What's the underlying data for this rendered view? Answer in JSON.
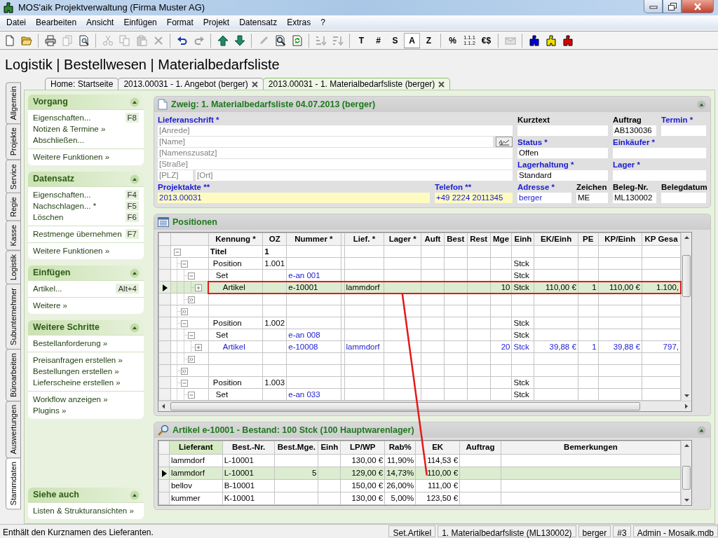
{
  "window": {
    "title": "MOS'aik Projektverwaltung (Firma Muster AG)"
  },
  "menu": [
    "Datei",
    "Bearbeiten",
    "Ansicht",
    "Einfügen",
    "Format",
    "Projekt",
    "Datensatz",
    "Extras",
    "?"
  ],
  "toolbar": [
    {
      "kind": "icon",
      "disabled": false
    },
    {
      "kind": "icon",
      "disabled": false
    },
    {
      "kind": "separator"
    },
    {
      "kind": "icon",
      "disabled": false
    },
    {
      "kind": "icon",
      "disabled": true
    },
    {
      "kind": "icon",
      "disabled": false
    },
    {
      "kind": "separator"
    },
    {
      "kind": "icon",
      "disabled": true
    },
    {
      "kind": "icon",
      "disabled": true
    },
    {
      "kind": "icon",
      "disabled": true
    },
    {
      "kind": "icon",
      "disabled": true
    },
    {
      "kind": "separator"
    },
    {
      "kind": "icon",
      "disabled": false
    },
    {
      "kind": "icon",
      "disabled": true
    },
    {
      "kind": "separator"
    },
    {
      "kind": "icon",
      "disabled": false
    },
    {
      "kind": "icon",
      "disabled": false
    },
    {
      "kind": "separator"
    },
    {
      "kind": "icon",
      "disabled": true
    },
    {
      "kind": "icon",
      "disabled": false
    },
    {
      "kind": "icon",
      "disabled": false
    },
    {
      "kind": "separator"
    },
    {
      "kind": "icon",
      "disabled": true
    },
    {
      "kind": "icon",
      "disabled": true
    },
    {
      "kind": "separator"
    },
    {
      "kind": "text",
      "label": "T",
      "selected": false
    },
    {
      "kind": "text",
      "label": "#",
      "selected": false
    },
    {
      "kind": "text",
      "label": "S",
      "selected": false
    },
    {
      "kind": "text",
      "label": "A",
      "selected": true
    },
    {
      "kind": "text",
      "label": "Z",
      "selected": false
    },
    {
      "kind": "separator"
    },
    {
      "kind": "text",
      "label": "%",
      "selected": false
    },
    {
      "kind": "text",
      "label": "1.1.1 1.1.2",
      "selected": false
    },
    {
      "kind": "text",
      "label": "€$",
      "selected": false
    },
    {
      "kind": "separator"
    },
    {
      "kind": "icon",
      "disabled": true
    },
    {
      "kind": "separator"
    },
    {
      "kind": "icon",
      "disabled": false,
      "color": "#0000e0"
    },
    {
      "kind": "icon",
      "disabled": false,
      "color": "#f0e000"
    },
    {
      "kind": "icon",
      "disabled": false,
      "color": "#e00000"
    }
  ],
  "page_title": "Logistik | Bestellwesen | Materialbedarfsliste",
  "side_tabs": [
    {
      "label": "Allgemein",
      "selected": false
    },
    {
      "label": "Projekte",
      "selected": false
    },
    {
      "label": "Service",
      "selected": false
    },
    {
      "label": "Regie",
      "selected": false
    },
    {
      "label": "Kasse",
      "selected": false
    },
    {
      "label": "Logistik",
      "selected": false
    },
    {
      "label": "Subunternehmer",
      "selected": false
    },
    {
      "label": "Büroarbeiten",
      "selected": false
    },
    {
      "label": "Auswertungen",
      "selected": false
    },
    {
      "label": "Stammdaten",
      "selected": true
    }
  ],
  "doc_tabs": [
    {
      "label": "Home: Startseite",
      "selected": false,
      "closable": false
    },
    {
      "label": "2013.00031 - 1. Angebot (berger)",
      "selected": false,
      "closable": true
    },
    {
      "label": "2013.00031 - 1. Materialbedarfsliste (berger)",
      "selected": true,
      "closable": true
    }
  ],
  "task_sections": [
    {
      "title": "Vorgang",
      "expanded": true,
      "groups": [
        [
          {
            "label": "Eigenschaften...",
            "shortcut": "F8"
          },
          {
            "label": "Notizen & Termine »"
          },
          {
            "label": "Abschließen..."
          }
        ],
        [
          {
            "label": "Weitere Funktionen »"
          }
        ]
      ]
    },
    {
      "title": "Datensatz",
      "expanded": true,
      "groups": [
        [
          {
            "label": "Eigenschaften...",
            "shortcut": "F4"
          },
          {
            "label": "Nachschlagen... *",
            "shortcut": "F5"
          },
          {
            "label": "Löschen",
            "shortcut": "F6"
          }
        ],
        [
          {
            "label": "Restmenge übernehmen",
            "shortcut": "F7"
          }
        ],
        [
          {
            "label": "Weitere Funktionen »"
          }
        ]
      ]
    },
    {
      "title": "Einfügen",
      "expanded": true,
      "groups": [
        [
          {
            "label": "Artikel...",
            "shortcut": "Alt+4"
          }
        ],
        [
          {
            "label": "Weitere »"
          }
        ]
      ]
    },
    {
      "title": "Weitere Schritte",
      "expanded": true,
      "groups": [
        [
          {
            "label": "Bestellanforderung »"
          }
        ],
        [
          {
            "label": "Preisanfragen erstellen »"
          },
          {
            "label": "Bestellungen erstellen »"
          },
          {
            "label": "Lieferscheine erstellen »"
          }
        ],
        [
          {
            "label": "Workflow anzeigen »"
          },
          {
            "label": "Plugins »"
          }
        ]
      ]
    },
    {
      "title": "Siehe auch",
      "expanded": true,
      "groups": [
        [
          {
            "label": "Listen & Strukturansichten »"
          }
        ]
      ]
    }
  ],
  "branch_panel": {
    "title": "Zweig: 1. Materialbedarfsliste 04.07.2013 (berger)",
    "expanded": true,
    "address_label": {
      "text": "Lieferanschrift *",
      "required": true
    },
    "address_fields": [
      {
        "placeholder": "[Anrede]",
        "lookup": false
      },
      {
        "placeholder": "[Name]",
        "lookup": true
      },
      {
        "placeholder": "[Namenszusatz]",
        "lookup": false
      },
      {
        "placeholder": "[Straße]",
        "lookup": false
      },
      {
        "placeholder": "[PLZ]",
        "lookup": false
      },
      {
        "placeholder": "[Ort]",
        "lookup": false
      }
    ],
    "fields": [
      {
        "label": "Kurztext",
        "required": false,
        "linked": false,
        "highlighted": false
      },
      {
        "label": "Auftrag",
        "required": false,
        "value": "AB130036",
        "linked": false,
        "highlighted": false
      },
      {
        "label": "Termin *",
        "required": true,
        "linked": false,
        "highlighted": false
      },
      {
        "label": "Status *",
        "required": true,
        "value": "Offen",
        "linked": false,
        "highlighted": false
      },
      {
        "label": "Einkäufer *",
        "required": true,
        "linked": false,
        "highlighted": false
      },
      {
        "label": "Lagerhaltung *",
        "required": true,
        "value": "Standard",
        "linked": false,
        "highlighted": false
      },
      {
        "label": "Lager *",
        "required": true,
        "linked": false,
        "highlighted": false
      },
      {
        "label": "Projektakte **",
        "required": true,
        "value": "2013.00031",
        "linked": true,
        "highlighted": true
      },
      {
        "label": "Telefon **",
        "required": true,
        "value": "+49 2224 2011345",
        "linked": true,
        "highlighted": true
      },
      {
        "label": "Adresse *",
        "required": true,
        "value": "berger",
        "linked": true,
        "highlighted": false
      },
      {
        "label": "Zeichen",
        "required": false,
        "value": "ME",
        "linked": false,
        "highlighted": false
      },
      {
        "label": "Beleg-Nr.",
        "required": false,
        "value": "ML130002",
        "linked": false,
        "highlighted": false
      },
      {
        "label": "Belegdatum",
        "required": false,
        "linked": false,
        "highlighted": false
      }
    ]
  },
  "positions_panel": {
    "title": "Positionen",
    "columns": [
      "Kennung *",
      "OZ",
      "Nummer *",
      "Lief. *",
      "Lager *",
      "Auft",
      "Best",
      "Rest",
      "Mge",
      "Einh",
      "EK/Einh",
      "PE",
      "KP/Einh",
      "KP Gesa"
    ],
    "tree": [
      {
        "kind": "title",
        "expanded": true,
        "selected": false,
        "linked": false,
        "cells": [
          "Titel",
          "1",
          null,
          null,
          null,
          null,
          null,
          null,
          null,
          null,
          null,
          null,
          null,
          null
        ],
        "children": [
          {
            "kind": "position",
            "expanded": true,
            "selected": false,
            "linked": false,
            "cells": [
              "Position",
              "1.001",
              null,
              null,
              null,
              null,
              null,
              null,
              null,
              "Stck",
              null,
              null,
              null,
              null
            ],
            "children": [
              {
                "kind": "set",
                "expanded": true,
                "selected": false,
                "linked": false,
                "cells": [
                  "Set",
                  null,
                  {
                    "text": "e-an 001",
                    "linked": true
                  },
                  null,
                  null,
                  null,
                  null,
                  null,
                  null,
                  "Stck",
                  null,
                  null,
                  null,
                  null
                ],
                "children": [
                  {
                    "kind": "article",
                    "expanded": false,
                    "selected": true,
                    "linked": false,
                    "cells": [
                      "Artikel",
                      null,
                      "e-10001",
                      "lammdorf",
                      null,
                      null,
                      null,
                      null,
                      "10",
                      "Stck",
                      "110,00 €",
                      "1",
                      "110,00 €",
                      "1.100,"
                    ]
                  }
                ]
              },
              {
                "kind": "add",
                "selected": false
              }
            ]
          },
          {
            "kind": "add",
            "selected": false
          },
          {
            "kind": "position",
            "expanded": true,
            "selected": false,
            "linked": false,
            "cells": [
              "Position",
              "1.002",
              null,
              null,
              null,
              null,
              null,
              null,
              null,
              "Stck",
              null,
              null,
              null,
              null
            ],
            "children": [
              {
                "kind": "set",
                "expanded": true,
                "selected": false,
                "linked": false,
                "cells": [
                  "Set",
                  null,
                  {
                    "text": "e-an 008",
                    "linked": true
                  },
                  null,
                  null,
                  null,
                  null,
                  null,
                  null,
                  "Stck",
                  null,
                  null,
                  null,
                  null
                ],
                "children": [
                  {
                    "kind": "article",
                    "expanded": false,
                    "selected": false,
                    "linked": true,
                    "cells": [
                      "Artikel",
                      null,
                      "e-10008",
                      "lammdorf",
                      null,
                      null,
                      null,
                      null,
                      "20",
                      "Stck",
                      "39,88 €",
                      "1",
                      "39,88 €",
                      "797,"
                    ]
                  }
                ]
              },
              {
                "kind": "add",
                "selected": false
              }
            ]
          },
          {
            "kind": "add",
            "selected": false
          },
          {
            "kind": "position",
            "expanded": true,
            "selected": false,
            "linked": false,
            "cells": [
              "Position",
              "1.003",
              null,
              null,
              null,
              null,
              null,
              null,
              null,
              "Stck",
              null,
              null,
              null,
              null
            ],
            "children": [
              {
                "kind": "set",
                "expanded": true,
                "selected": false,
                "linked": false,
                "cells": [
                  "Set",
                  null,
                  {
                    "text": "e-an 033",
                    "linked": true
                  },
                  null,
                  null,
                  null,
                  null,
                  null,
                  null,
                  "Stck",
                  null,
                  null,
                  null,
                  null
                ]
              }
            ]
          }
        ]
      }
    ]
  },
  "article_panel": {
    "title": "Artikel e-10001 - Bestand: 100 Stck (100 Hauptwarenlager)",
    "expanded": true,
    "columns": [
      {
        "label": "Lieferant",
        "sorted": true
      },
      {
        "label": "Best.-Nr.",
        "sorted": false
      },
      {
        "label": "Best.Mge.",
        "sorted": false
      },
      {
        "label": "Einh",
        "sorted": false
      },
      {
        "label": "LP/WP",
        "sorted": false
      },
      {
        "label": "Rab%",
        "sorted": false
      },
      {
        "label": "EK",
        "sorted": false
      },
      {
        "label": "Auftrag",
        "sorted": false
      },
      {
        "label": "Bemerkungen",
        "sorted": false
      }
    ],
    "rows": [
      {
        "selected": false,
        "cells": [
          "lammdorf",
          "L-10001",
          null,
          null,
          "130,00 €",
          "11,90%",
          "114,53 €",
          null,
          null
        ]
      },
      {
        "selected": true,
        "cells": [
          "lammdorf",
          "L-10001",
          "5",
          null,
          "129,00 €",
          "14,73%",
          "110,00 €",
          null,
          null
        ]
      },
      {
        "selected": false,
        "cells": [
          "bellov",
          "B-10001",
          null,
          null,
          "150,00 €",
          "26,00%",
          "111,00 €",
          null,
          null
        ]
      },
      {
        "selected": false,
        "cells": [
          "kummer",
          "K-10001",
          null,
          null,
          "130,00 €",
          "5,00%",
          "123,50 €",
          null,
          null
        ]
      }
    ]
  },
  "annotation": {
    "kind": "connector"
  },
  "status_bar": {
    "message": "Enthält den Kurznamen des Lieferanten.",
    "panes": [
      "Set.Artikel",
      "1. Materialbedarfsliste (ML130002)",
      "berger",
      "#3",
      "Admin - Mosaik.mdb"
    ]
  }
}
